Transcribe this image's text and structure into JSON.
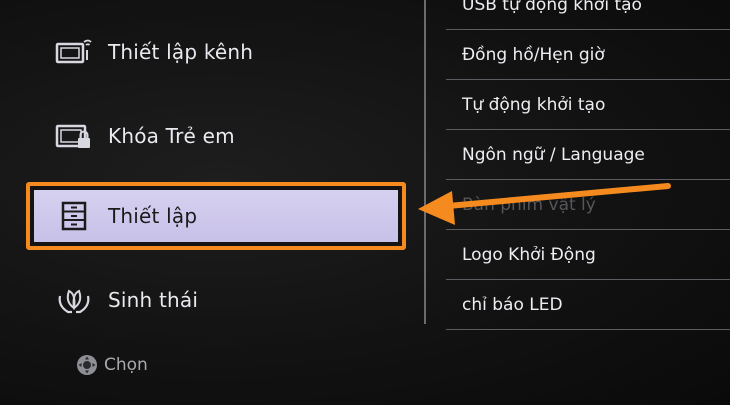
{
  "left_menu": {
    "items": [
      {
        "label": "Thiết lập kênh",
        "icon": "tv-antenna-icon"
      },
      {
        "label": "Khóa Trẻ em",
        "icon": "tv-lock-icon"
      },
      {
        "label": "Thiết lập",
        "icon": "toolbox-icon",
        "selected": true
      },
      {
        "label": "Sinh thái",
        "icon": "leaf-hands-icon"
      }
    ]
  },
  "hint": {
    "label": "Chọn",
    "icon": "dpad-icon"
  },
  "right_list": {
    "items": [
      {
        "label": "USB tự động khởi tạo"
      },
      {
        "label": "Đồng hồ/Hẹn giờ"
      },
      {
        "label": "Tự động khởi tạo"
      },
      {
        "label": "Ngôn ngữ / Language"
      },
      {
        "label": "Bàn phím vật lý",
        "disabled": true
      },
      {
        "label": "Logo Khởi Động"
      },
      {
        "label": "chỉ báo LED"
      }
    ]
  },
  "colors": {
    "highlight_border": "#f58a1f",
    "highlight_fill": "#d2ccee",
    "arrow": "#f58a1f"
  }
}
